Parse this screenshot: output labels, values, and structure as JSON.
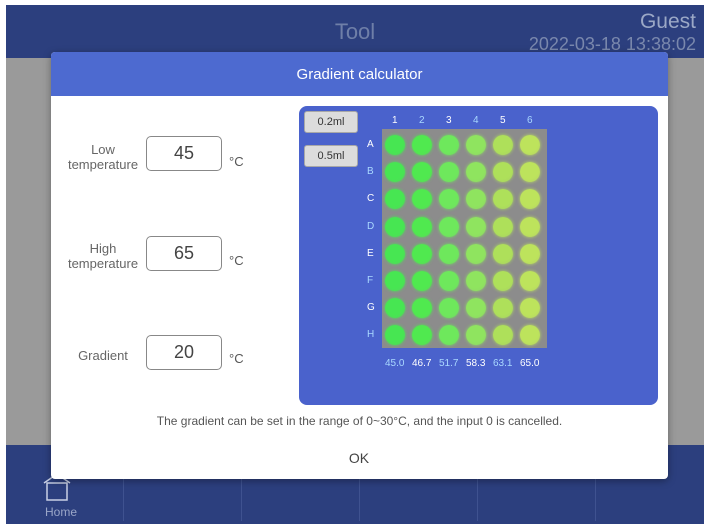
{
  "app": {
    "title": "Tool",
    "user": "Guest",
    "datetime": "2022-03-18 13:38:02",
    "colors": {
      "bar": "#2c3f7e",
      "backdrop": "#9a9a9a",
      "accent": "#4d6ad0"
    }
  },
  "bottom_nav": {
    "home_label": "Home",
    "home_icon": "home-icon"
  },
  "dialog": {
    "title": "Gradient calculator",
    "low": {
      "label_line1": "Low",
      "label_line2": "temperature",
      "value": "45",
      "unit": "°C"
    },
    "high": {
      "label_line1": "High",
      "label_line2": "temperature",
      "value": "65",
      "unit": "°C"
    },
    "gradient": {
      "label": "Gradient",
      "value": "20",
      "unit": "°C"
    },
    "note": "The gradient can be set in the range of 0~30°C, and the input 0 is cancelled.",
    "ok_label": "OK"
  },
  "plate": {
    "size_buttons": [
      "0.2ml",
      "0.5ml"
    ],
    "columns": [
      "1",
      "2",
      "3",
      "4",
      "5",
      "6"
    ],
    "rows": [
      "A",
      "B",
      "C",
      "D",
      "E",
      "F",
      "G",
      "H"
    ],
    "column_temps": [
      "45.0",
      "46.7",
      "51.7",
      "58.3",
      "63.1",
      "65.0"
    ],
    "column_well_colors": [
      "#47e652",
      "#50e94f",
      "#6ee85c",
      "#8fe45f",
      "#aee05a",
      "#bde35c"
    ],
    "label_colors": {
      "light": "#a9d8ff",
      "white": "#ffffff"
    }
  }
}
